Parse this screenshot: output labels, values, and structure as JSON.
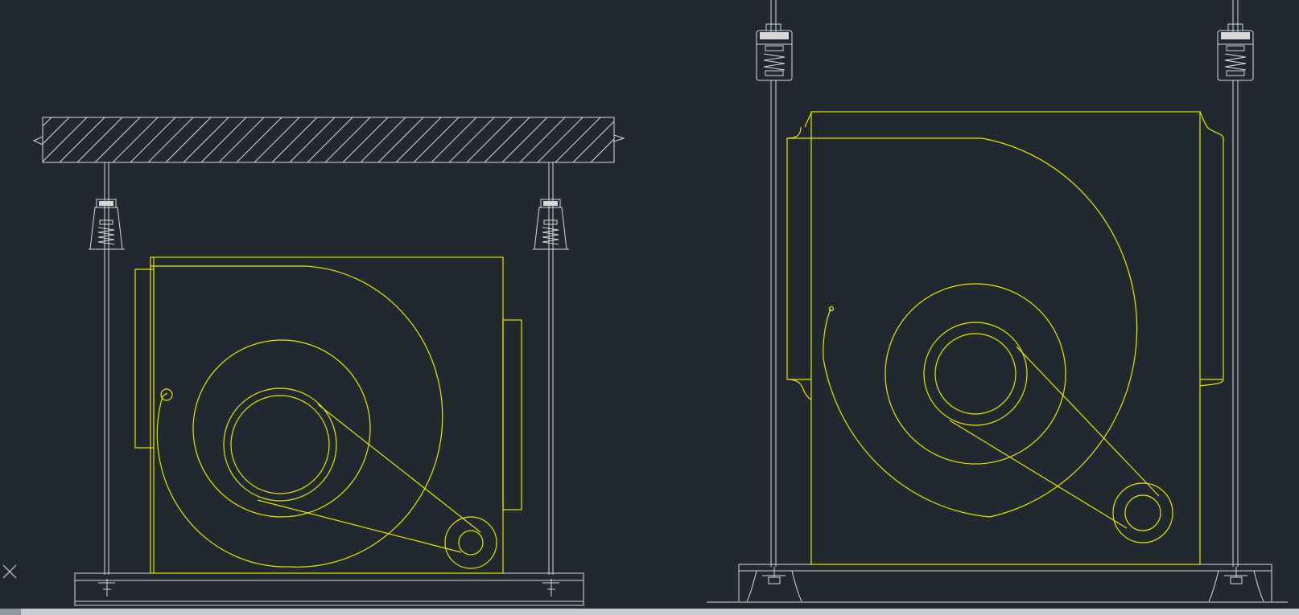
{
  "drawing": {
    "background": "#212830",
    "line_colors": {
      "structure": "#d8d8d8",
      "fan": "#e6e600"
    },
    "views": [
      {
        "name": "left-elevation",
        "support": "ceiling-slab-with-spring-hangers"
      },
      {
        "name": "right-elevation",
        "support": "spring-hangers-and-base-frame"
      }
    ],
    "ucs_icon": "x-cross-icon"
  },
  "ui": {
    "horizontal_scrollbar": true
  }
}
